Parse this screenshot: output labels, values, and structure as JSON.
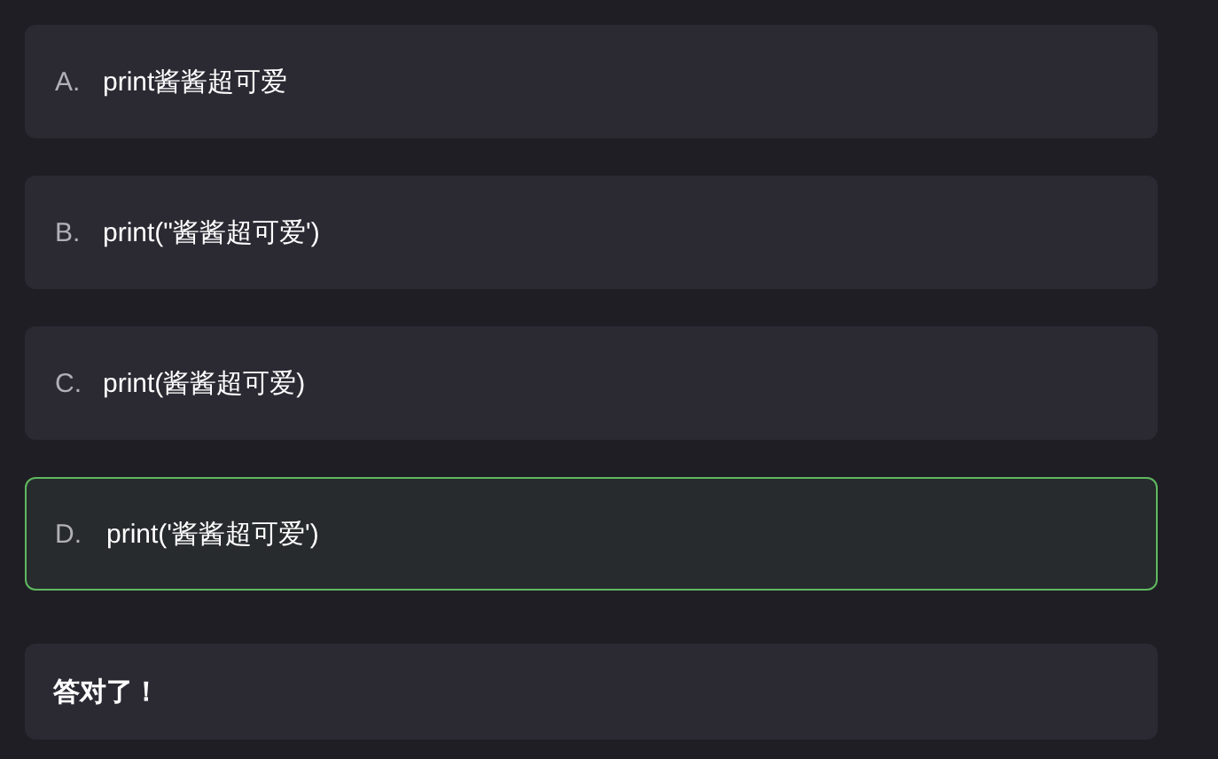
{
  "options": [
    {
      "letter": "A.",
      "text": "print酱酱超可爱",
      "selected": false
    },
    {
      "letter": "B.",
      "text": "print(\"酱酱超可爱')",
      "selected": false
    },
    {
      "letter": "C.",
      "text": "print(酱酱超可爱)",
      "selected": false
    },
    {
      "letter": "D.",
      "text": "print('酱酱超可爱')",
      "selected": true
    }
  ],
  "feedback": "答对了！"
}
